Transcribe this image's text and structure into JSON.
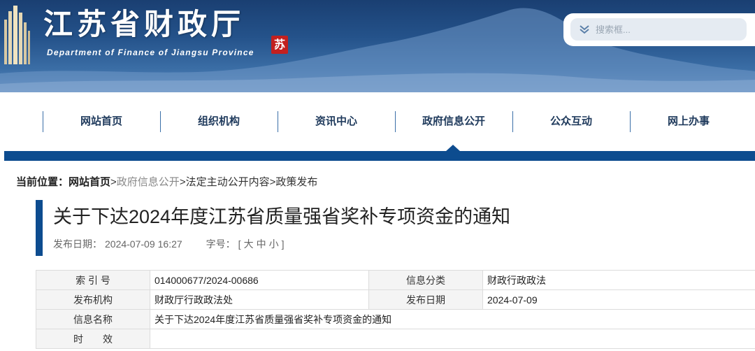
{
  "header": {
    "title": "江苏省财政厅",
    "subtitle": "Department of Finance of Jiangsu Province",
    "seal_text": "苏",
    "search": {
      "placeholder": "搜索框..."
    }
  },
  "nav": {
    "items": [
      {
        "label": "网站首页"
      },
      {
        "label": "组织机构"
      },
      {
        "label": "资讯中心"
      },
      {
        "label": "政府信息公开",
        "active": true
      },
      {
        "label": "公众互动"
      },
      {
        "label": "网上办事"
      }
    ]
  },
  "breadcrumb": {
    "label": "当前位置：",
    "items": [
      "网站首页",
      "政府信息公开",
      "法定主动公开内容",
      "政策发布"
    ],
    "separator": ">"
  },
  "article": {
    "title": "关于下达2024年度江苏省质量强省奖补专项资金的通知",
    "publish_label": "发布日期：",
    "publish_date": "2024-07-09",
    "publish_time": "16:27",
    "font_label": "字号：",
    "font_open": "[",
    "font_large": "大",
    "font_medium": "中",
    "font_small": "小",
    "font_close": "]"
  },
  "info_table": {
    "index_key": "索 引 号",
    "index_value": "014000677/2024-00686",
    "category_key": "信息分类",
    "category_value": "财政行政政法",
    "publisher_key": "发布机构",
    "publisher_value": "财政厅行政政法处",
    "date_key": "发布日期",
    "date_value": "2024-07-09",
    "name_key": "信息名称",
    "name_value": "关于下达2024年度江苏省质量强省奖补专项资金的通知",
    "validity_key": "时　　效",
    "validity_value": ""
  },
  "colors": {
    "brand_blue": "#0d4c8f",
    "nav_text": "#1f3a5c",
    "seal_red": "#c3201f"
  }
}
